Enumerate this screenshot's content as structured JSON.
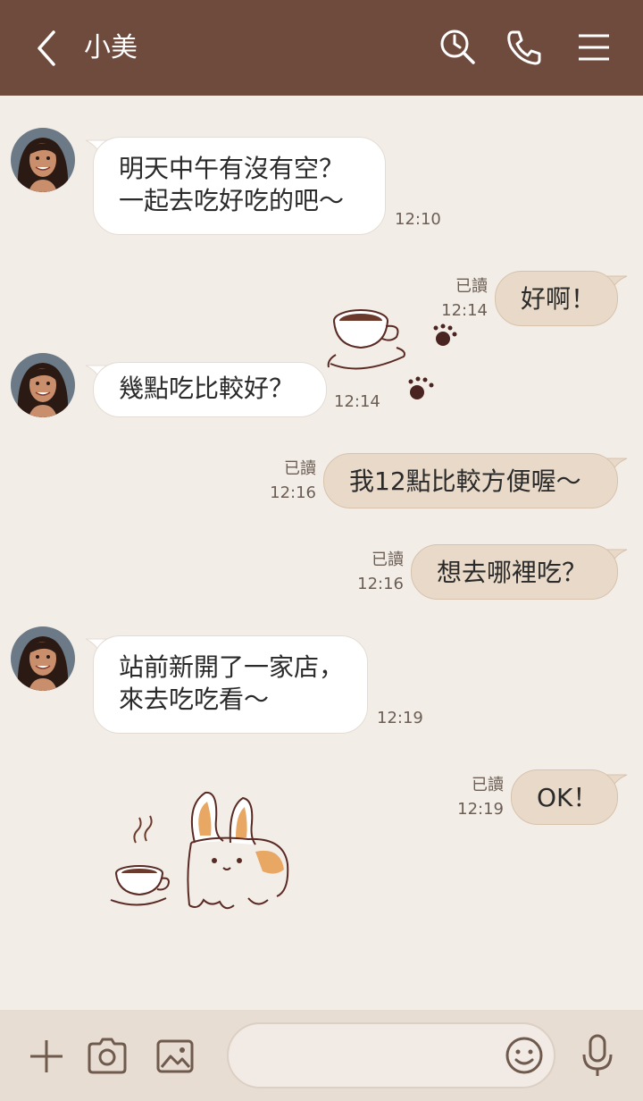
{
  "header": {
    "title": "小美",
    "back_icon": "chevron-left-icon",
    "search_icon": "search-icon",
    "call_icon": "phone-icon",
    "menu_icon": "menu-icon",
    "bg_color": "#6f4b3e"
  },
  "messages": [
    {
      "from": "friend",
      "lines": [
        "明天中午有沒有空？",
        "一起去吃好吃的吧～"
      ],
      "time": "12:10"
    },
    {
      "from": "me",
      "text": "好啊！",
      "read": "已讀",
      "time": "12:14"
    },
    {
      "from": "friend",
      "lines": [
        "幾點吃比較好？"
      ],
      "time": "12:14"
    },
    {
      "from": "me",
      "text": "我12點比較方便喔～",
      "read": "已讀",
      "time": "12:16"
    },
    {
      "from": "me",
      "text": "想去哪裡吃？",
      "read": "已讀",
      "time": "12:16"
    },
    {
      "from": "friend",
      "lines": [
        "站前新開了一家店，",
        "來去吃吃看～"
      ],
      "time": "12:19"
    },
    {
      "from": "me",
      "text": "OK！",
      "read": "已讀",
      "time": "12:19"
    }
  ],
  "decorations": [
    "coffee-cup-icon",
    "paw-print-icon",
    "rabbit-dog-sticker-icon"
  ],
  "footer": {
    "plus_icon": "plus-icon",
    "camera_icon": "camera-icon",
    "image_icon": "image-icon",
    "input_placeholder": "",
    "emoji_icon": "smiley-icon",
    "mic_icon": "microphone-icon"
  },
  "colors": {
    "background": "#f3ede7",
    "outgoing_bubble": "#e8d9c8",
    "incoming_bubble": "#ffffff",
    "footer": "#e8ddd3"
  }
}
